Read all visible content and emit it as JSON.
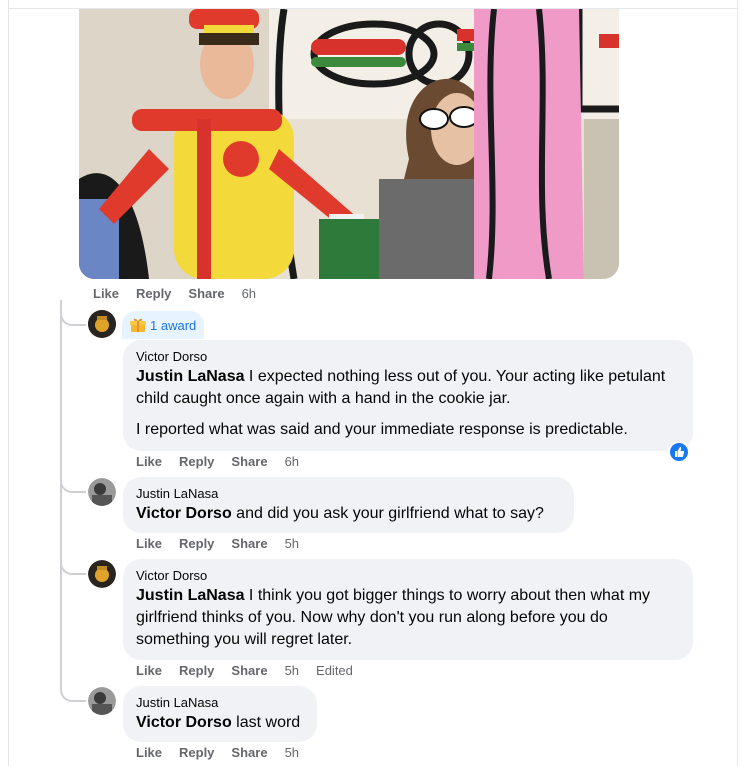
{
  "post_media": {
    "alt_icon": "video-frame-image"
  },
  "post_actions": {
    "like": "Like",
    "reply": "Reply",
    "share": "Share",
    "time": "6h"
  },
  "comments": [
    {
      "award": "1 award",
      "author": "Victor Dorso",
      "mention": "Justin LaNasa",
      "text": " I expected nothing less out of you. Your acting like petulant child caught once again with a hand in the cookie jar.",
      "text2": "I reported what was said and your immediate response is predictable.",
      "like": "Like",
      "reply": "Reply",
      "share": "Share",
      "time": "6h",
      "reaction": "thumbs-up-icon"
    },
    {
      "author": "Justin LaNasa",
      "mention": "Victor Dorso",
      "text": " and did you ask your girlfriend what to say?",
      "like": "Like",
      "reply": "Reply",
      "share": "Share",
      "time": "5h"
    },
    {
      "author": "Victor Dorso",
      "mention": "Justin LaNasa",
      "text": " I think you got bigger things to worry about then what my girlfriend thinks of you. Now why don't you run along before you do something you will regret later.",
      "like": "Like",
      "reply": "Reply",
      "share": "Share",
      "time": "5h",
      "edited": "Edited"
    },
    {
      "author": "Justin LaNasa",
      "mention": "Victor Dorso",
      "text": " last word",
      "like": "Like",
      "reply": "Reply",
      "share": "Share",
      "time": "5h"
    }
  ],
  "colors": {
    "accent": "#1877f2",
    "bubble": "#f0f2f5",
    "meta": "#65676b"
  }
}
